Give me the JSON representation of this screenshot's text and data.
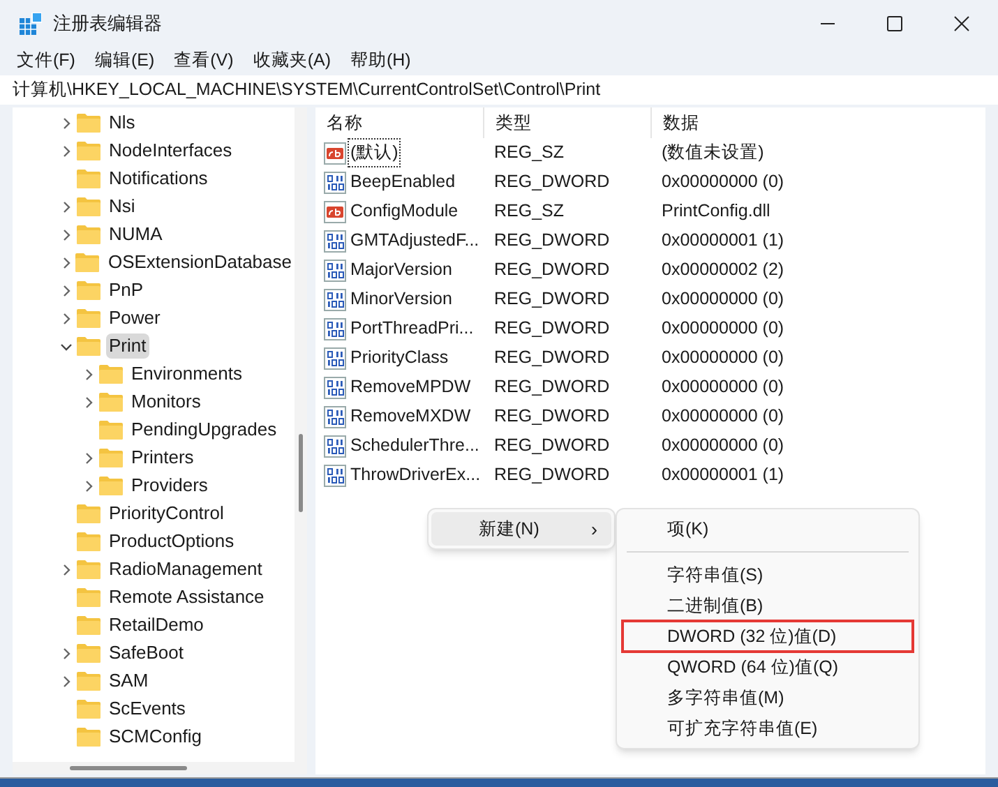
{
  "window": {
    "title": "注册表编辑器"
  },
  "menu_bar": [
    "文件(F)",
    "编辑(E)",
    "查看(V)",
    "收藏夹(A)",
    "帮助(H)"
  ],
  "address_bar": "计算机\\HKEY_LOCAL_MACHINE\\SYSTEM\\CurrentControlSet\\Control\\Print",
  "tree": [
    {
      "label": "Nls",
      "has_children": true,
      "expanded": false,
      "selected": false
    },
    {
      "label": "NodeInterfaces",
      "has_children": true,
      "expanded": false,
      "selected": false
    },
    {
      "label": "Notifications",
      "has_children": false,
      "selected": false
    },
    {
      "label": "Nsi",
      "has_children": true,
      "expanded": false,
      "selected": false
    },
    {
      "label": "NUMA",
      "has_children": true,
      "expanded": false,
      "selected": false
    },
    {
      "label": "OSExtensionDatabase",
      "has_children": true,
      "expanded": false,
      "selected": false
    },
    {
      "label": "PnP",
      "has_children": true,
      "expanded": false,
      "selected": false
    },
    {
      "label": "Power",
      "has_children": true,
      "expanded": false,
      "selected": false
    },
    {
      "label": "Print",
      "has_children": true,
      "expanded": true,
      "selected": true,
      "children": [
        {
          "label": "Environments",
          "has_children": true,
          "expanded": false,
          "selected": false
        },
        {
          "label": "Monitors",
          "has_children": true,
          "expanded": false,
          "selected": false
        },
        {
          "label": "PendingUpgrades",
          "has_children": false,
          "selected": false
        },
        {
          "label": "Printers",
          "has_children": true,
          "expanded": false,
          "selected": false
        },
        {
          "label": "Providers",
          "has_children": true,
          "expanded": false,
          "selected": false
        }
      ]
    },
    {
      "label": "PriorityControl",
      "has_children": false,
      "selected": false
    },
    {
      "label": "ProductOptions",
      "has_children": false,
      "selected": false
    },
    {
      "label": "RadioManagement",
      "has_children": true,
      "expanded": false,
      "selected": false
    },
    {
      "label": "Remote Assistance",
      "has_children": false,
      "selected": false
    },
    {
      "label": "RetailDemo",
      "has_children": false,
      "selected": false
    },
    {
      "label": "SafeBoot",
      "has_children": true,
      "expanded": false,
      "selected": false
    },
    {
      "label": "SAM",
      "has_children": true,
      "expanded": false,
      "selected": false
    },
    {
      "label": "ScEvents",
      "has_children": false,
      "selected": false
    },
    {
      "label": "SCMConfig",
      "has_children": false,
      "selected": false
    }
  ],
  "values_table": {
    "columns": [
      "名称",
      "类型",
      "数据"
    ],
    "rows": [
      {
        "kind": "string",
        "name": "(默认)",
        "type": "REG_SZ",
        "data": "(数值未设置)",
        "focused": true
      },
      {
        "kind": "dword",
        "name": "BeepEnabled",
        "type": "REG_DWORD",
        "data": "0x00000000 (0)",
        "focused": false
      },
      {
        "kind": "string",
        "name": "ConfigModule",
        "type": "REG_SZ",
        "data": "PrintConfig.dll",
        "focused": false
      },
      {
        "kind": "dword",
        "name": "GMTAdjustedF...",
        "type": "REG_DWORD",
        "data": "0x00000001 (1)",
        "focused": false
      },
      {
        "kind": "dword",
        "name": "MajorVersion",
        "type": "REG_DWORD",
        "data": "0x00000002 (2)",
        "focused": false
      },
      {
        "kind": "dword",
        "name": "MinorVersion",
        "type": "REG_DWORD",
        "data": "0x00000000 (0)",
        "focused": false
      },
      {
        "kind": "dword",
        "name": "PortThreadPri...",
        "type": "REG_DWORD",
        "data": "0x00000000 (0)",
        "focused": false
      },
      {
        "kind": "dword",
        "name": "PriorityClass",
        "type": "REG_DWORD",
        "data": "0x00000000 (0)",
        "focused": false
      },
      {
        "kind": "dword",
        "name": "RemoveMPDW",
        "type": "REG_DWORD",
        "data": "0x00000000 (0)",
        "focused": false
      },
      {
        "kind": "dword",
        "name": "RemoveMXDW",
        "type": "REG_DWORD",
        "data": "0x00000000 (0)",
        "focused": false
      },
      {
        "kind": "dword",
        "name": "SchedulerThre...",
        "type": "REG_DWORD",
        "data": "0x00000000 (0)",
        "focused": false
      },
      {
        "kind": "dword",
        "name": "ThrowDriverEx...",
        "type": "REG_DWORD",
        "data": "0x00000001 (1)",
        "focused": false
      }
    ]
  },
  "context_menu": {
    "items": [
      {
        "label": "新建(N)",
        "selected": true,
        "arrow": "›"
      }
    ]
  },
  "submenu": {
    "items": [
      {
        "label": "项(K)",
        "highlighted": false,
        "separator_after": true
      },
      {
        "label": "字符串值(S)",
        "highlighted": false,
        "separator_after": false
      },
      {
        "label": "二进制值(B)",
        "highlighted": false,
        "separator_after": false
      },
      {
        "label": "DWORD (32 位)值(D)",
        "highlighted": true,
        "separator_after": false
      },
      {
        "label": "QWORD (64 位)值(Q)",
        "highlighted": false,
        "separator_after": false
      },
      {
        "label": "多字符串值(M)",
        "highlighted": false,
        "separator_after": false
      },
      {
        "label": "可扩充字符串值(E)",
        "highlighted": false,
        "separator_after": false
      }
    ]
  }
}
